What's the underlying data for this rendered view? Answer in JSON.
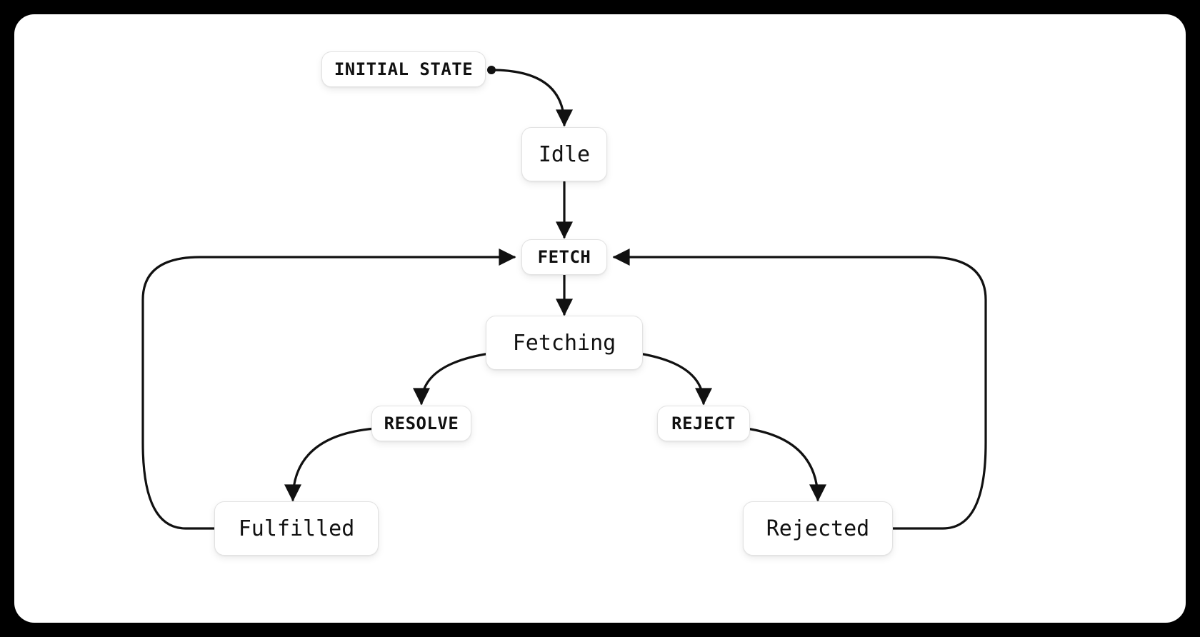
{
  "diagram": {
    "initial_label": "INITIAL STATE",
    "states": {
      "idle": "Idle",
      "fetching": "Fetching",
      "fulfilled": "Fulfilled",
      "rejected": "Rejected"
    },
    "transitions": {
      "fetch": "FETCH",
      "resolve": "RESOLVE",
      "reject": "REJECT"
    },
    "edges": [
      {
        "from": "initial",
        "to": "idle",
        "label": null
      },
      {
        "from": "idle",
        "to": "fetching",
        "label": "fetch"
      },
      {
        "from": "fetching",
        "to": "fulfilled",
        "label": "resolve"
      },
      {
        "from": "fetching",
        "to": "rejected",
        "label": "reject"
      },
      {
        "from": "fulfilled",
        "to": "fetching",
        "label": "fetch"
      },
      {
        "from": "rejected",
        "to": "fetching",
        "label": "fetch"
      }
    ]
  }
}
